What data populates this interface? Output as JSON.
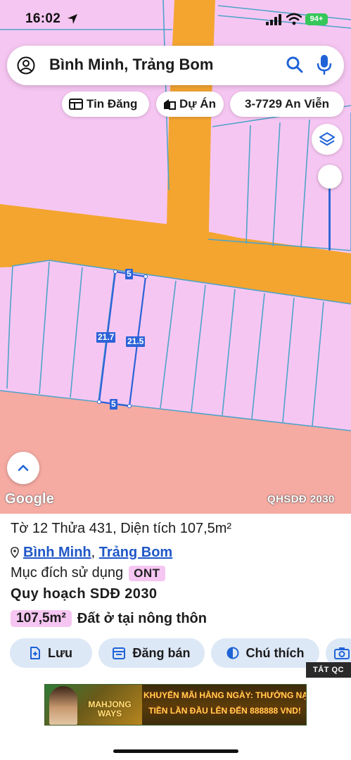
{
  "status_bar": {
    "time": "16:02",
    "battery": "94+"
  },
  "search": {
    "query": "Bình Minh, Trảng Bom"
  },
  "chips": [
    {
      "label": "Tin Đăng",
      "icon": "listing-icon"
    },
    {
      "label": "Dự Án",
      "icon": "building-icon"
    },
    {
      "label": "3-7729 An Viễn",
      "icon": ""
    }
  ],
  "map": {
    "attribution": "Google",
    "layer_label": "QHSDĐ 2030",
    "dimensions": {
      "top": "5",
      "left": "21.7",
      "right": "21.5",
      "bottom": "5"
    },
    "colors": {
      "residential": "#f6c6f2",
      "road": "#f3a530",
      "agricultural": "#f5aaa2",
      "lot_line": "#4fa3c9",
      "parcel_outline": "#2d63d8"
    }
  },
  "parcel": {
    "title": "Tờ 12 Thửa 431, Diện tích 107,5m²",
    "commune": "Bình Minh",
    "separator": ",",
    "district": "Trảng Bom",
    "purpose_label": "Mục đích sử dụng",
    "purpose_code": "ONT",
    "plan_heading": "Quy hoạch SDĐ 2030",
    "area": "107,5m²",
    "land_type": "Đất ở tại nông thôn"
  },
  "actions": {
    "save": "Lưu",
    "sell": "Đăng bán",
    "legend": "Chú thích"
  },
  "ad": {
    "close_label": "TẮT QC",
    "game_title": "MAHJONG WAYS",
    "line1": "KHUYẾN MÃI HẰNG NGÀY: THƯỞNG NẠP",
    "line2": "TIỀN LẦN ĐẦU LÊN ĐẾN 888888 VND!"
  }
}
